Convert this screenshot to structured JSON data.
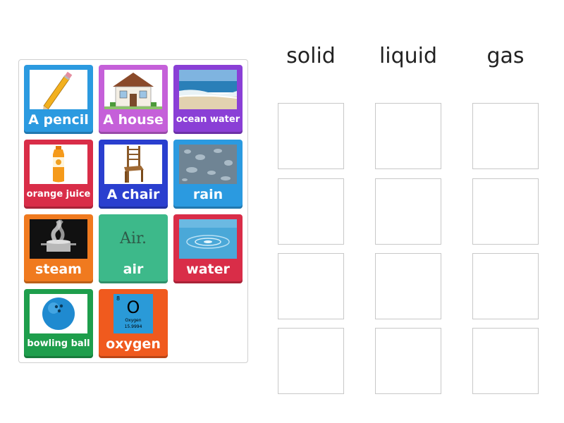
{
  "categories": [
    "solid",
    "liquid",
    "gas"
  ],
  "cards": [
    {
      "label": "A pencil",
      "color": "#2b9ae0",
      "icon": "pencil-icon"
    },
    {
      "label": "A house",
      "color": "#c560d9",
      "icon": "house-icon"
    },
    {
      "label": "ocean water",
      "color": "#8a3fd6",
      "icon": "ocean-icon"
    },
    {
      "label": "orange juice",
      "color": "#d92d48",
      "icon": "orange-juice-bottle-icon"
    },
    {
      "label": "A chair",
      "color": "#2a3fcf",
      "icon": "chair-icon"
    },
    {
      "label": "rain",
      "color": "#2b9ae0",
      "icon": "raindrops-icon"
    },
    {
      "label": "steam",
      "color": "#f07a1f",
      "icon": "steam-pot-icon"
    },
    {
      "label": "air",
      "color": "#3db98a",
      "icon": "air-text-icon",
      "image_text": "Air."
    },
    {
      "label": "water",
      "color": "#d92d48",
      "icon": "water-ripple-icon"
    },
    {
      "label": "bowling ball",
      "color": "#1e9e4c",
      "icon": "bowling-ball-icon"
    },
    {
      "label": "oxygen",
      "color": "#f05a1e",
      "icon": "oxygen-element-icon",
      "element": {
        "number": "8",
        "symbol": "O",
        "name": "Oxygen",
        "mass": "15.9994"
      }
    }
  ]
}
